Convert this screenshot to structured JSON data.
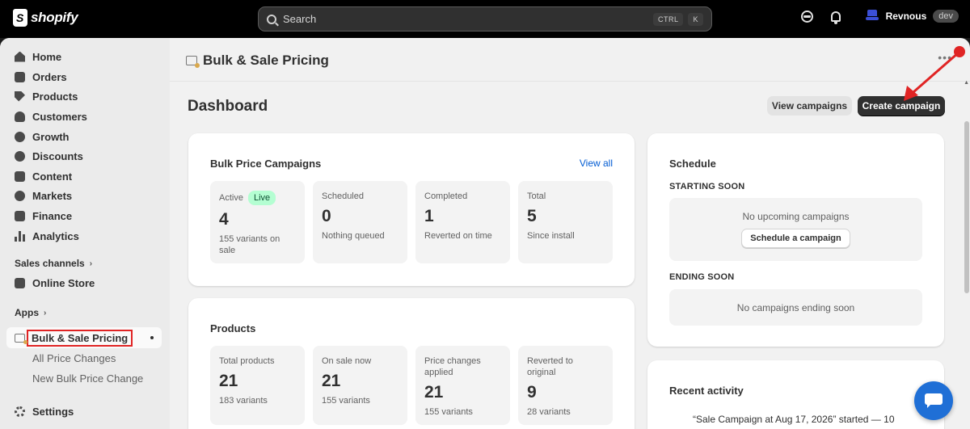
{
  "topbar": {
    "logo_text": "shopify",
    "search_placeholder": "Search",
    "kbd_ctrl": "CTRL",
    "kbd_k": "K",
    "store_name": "Revnous",
    "store_badge": "dev"
  },
  "sidebar": {
    "items": [
      {
        "label": "Home"
      },
      {
        "label": "Orders"
      },
      {
        "label": "Products"
      },
      {
        "label": "Customers"
      },
      {
        "label": "Growth"
      },
      {
        "label": "Discounts"
      },
      {
        "label": "Content"
      },
      {
        "label": "Markets"
      },
      {
        "label": "Finance"
      },
      {
        "label": "Analytics"
      }
    ],
    "sales_channels_label": "Sales channels",
    "online_store_label": "Online Store",
    "apps_label": "Apps",
    "app_name": "Bulk & Sale Pricing",
    "app_sub_items": [
      {
        "label": "All Price Changes"
      },
      {
        "label": "New Bulk Price Change"
      }
    ],
    "settings_label": "Settings"
  },
  "app_header": {
    "title": "Bulk & Sale Pricing"
  },
  "page": {
    "title": "Dashboard",
    "view_campaigns_label": "View campaigns",
    "create_campaign_label": "Create campaign"
  },
  "campaigns_card": {
    "title": "Bulk Price Campaigns",
    "view_all_label": "View all",
    "stats": [
      {
        "label": "Active",
        "badge": "Live",
        "value": "4",
        "sub": "155 variants on sale"
      },
      {
        "label": "Scheduled",
        "value": "0",
        "sub": "Nothing queued"
      },
      {
        "label": "Completed",
        "value": "1",
        "sub": "Reverted on time"
      },
      {
        "label": "Total",
        "value": "5",
        "sub": "Since install"
      }
    ]
  },
  "products_card": {
    "title": "Products",
    "stats": [
      {
        "label": "Total products",
        "value": "21",
        "sub": "183 variants"
      },
      {
        "label": "On sale now",
        "value": "21",
        "sub": "155 variants"
      },
      {
        "label": "Price changes applied",
        "value": "21",
        "sub": "155 variants"
      },
      {
        "label": "Reverted to original",
        "value": "9",
        "sub": "28 variants"
      }
    ]
  },
  "schedule_card": {
    "title": "Schedule",
    "starting_soon_label": "STARTING SOON",
    "no_upcoming_text": "No upcoming campaigns",
    "schedule_button_label": "Schedule a campaign",
    "ending_soon_label": "ENDING SOON",
    "no_ending_text": "No campaigns ending soon"
  },
  "activity_card": {
    "title": "Recent activity",
    "first_entry": "“Sale Campaign at Aug 17, 2026” started — 10"
  },
  "colors": {
    "accent_link": "#005bd3",
    "primary_button": "#303030",
    "live_badge_bg": "#b4fed2",
    "annotation_red": "#e02424"
  }
}
